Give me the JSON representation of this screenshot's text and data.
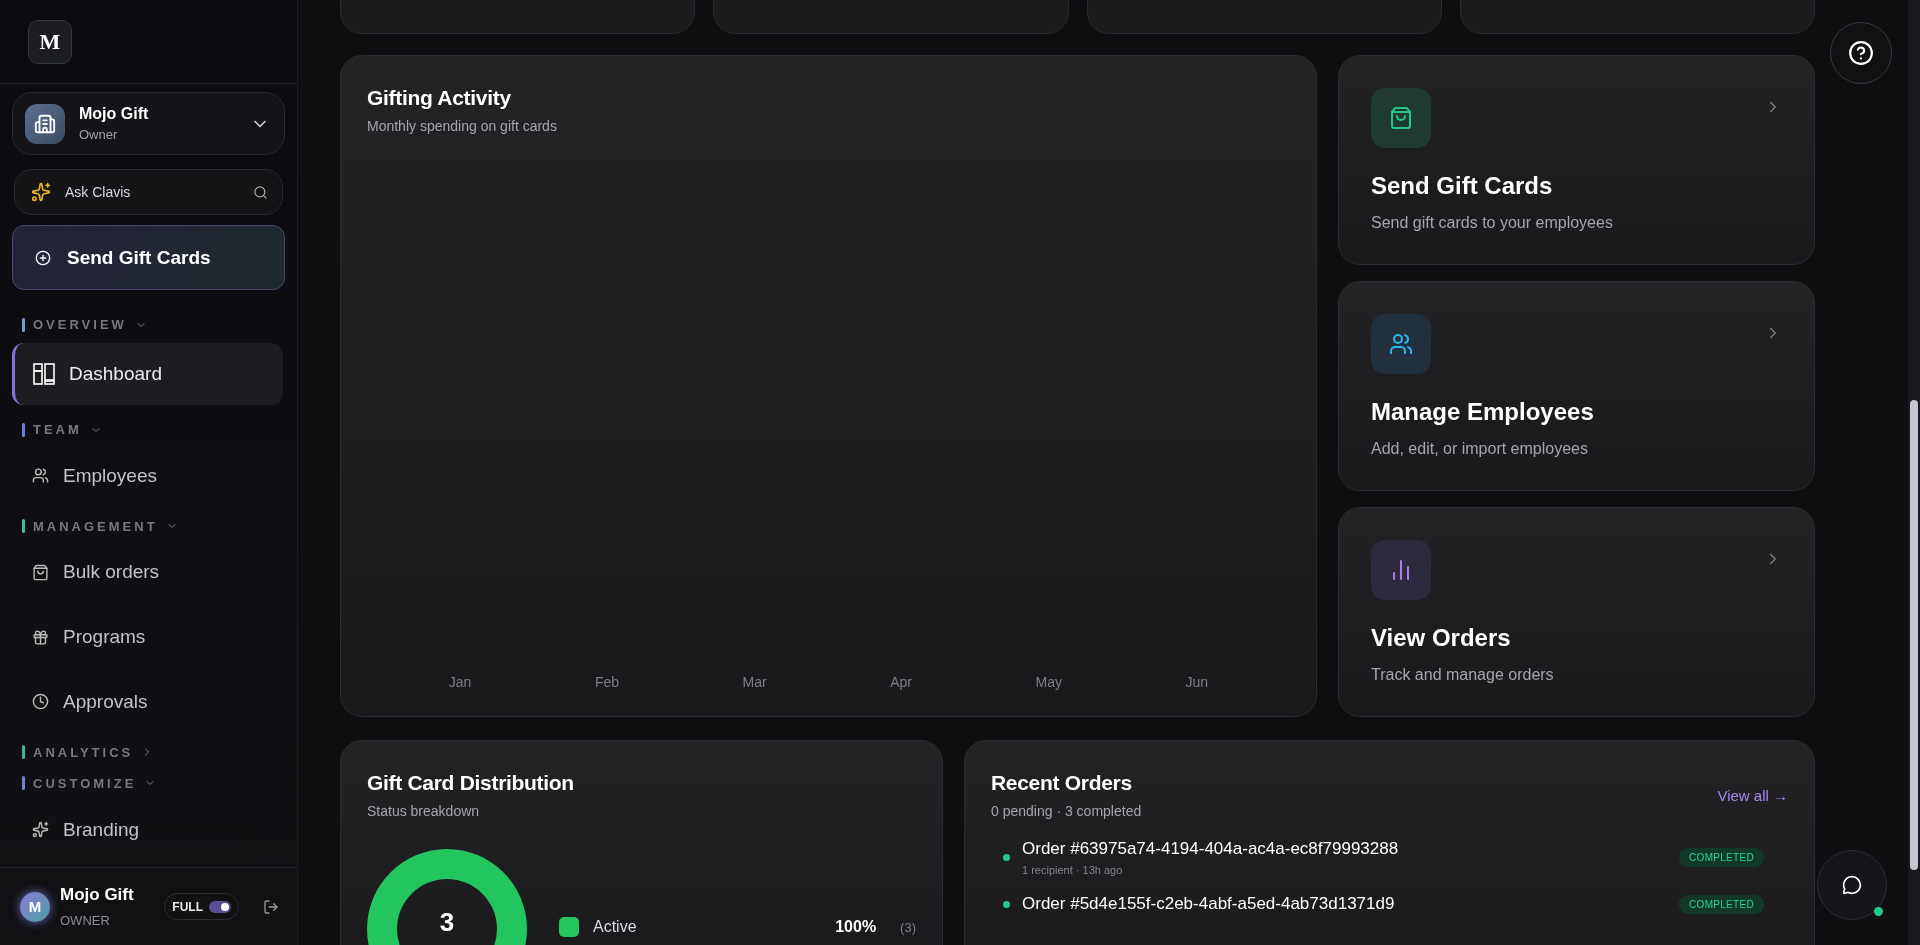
{
  "sidebar": {
    "logo": "M",
    "org": {
      "name": "Mojo Gift",
      "role": "Owner"
    },
    "ask": {
      "placeholder": "Ask Clavis"
    },
    "primary_button": "Send Gift Cards",
    "sections": [
      {
        "title": "OVERVIEW",
        "color": "#7c9ad0",
        "expanded": true,
        "items": [
          {
            "label": "Dashboard",
            "selected": true
          }
        ]
      },
      {
        "title": "TEAM",
        "color": "#6d7fe0",
        "expanded": true,
        "items": [
          {
            "label": "Employees",
            "selected": false
          }
        ]
      },
      {
        "title": "MANAGEMENT",
        "color": "#3fbf9f",
        "expanded": true,
        "items": [
          {
            "label": "Bulk orders",
            "selected": false
          },
          {
            "label": "Programs",
            "selected": false
          },
          {
            "label": "Approvals",
            "selected": false
          }
        ]
      },
      {
        "title": "ANALYTICS",
        "color": "#3fb99a",
        "expanded": false
      },
      {
        "title": "CUSTOMIZE",
        "color": "#7a7fd8",
        "expanded": true,
        "items": [
          {
            "label": "Branding",
            "selected": false
          }
        ]
      }
    ],
    "user": {
      "initial": "M",
      "name": "Mojo Gift",
      "role": "OWNER",
      "mode_label": "FULL",
      "mode_on": true
    }
  },
  "gifting_activity": {
    "title": "Gifting Activity",
    "subtitle": "Monthly spending on gift cards",
    "months": [
      "Jan",
      "Feb",
      "Mar",
      "Apr",
      "May",
      "Jun"
    ]
  },
  "actions": [
    {
      "title": "Send Gift Cards",
      "description": "Send gift cards to your employees",
      "color": "#22c98a"
    },
    {
      "title": "Manage Employees",
      "description": "Add, edit, or import employees",
      "color": "#2bb6f0"
    },
    {
      "title": "View Orders",
      "description": "Track and manage orders",
      "color": "#b07cf0"
    }
  ],
  "distribution": {
    "title": "Gift Card Distribution",
    "subtitle": "Status breakdown",
    "total": "3",
    "legend": [
      {
        "label": "Active",
        "color": "#22c55e",
        "percent": "100%",
        "count": "(3)"
      }
    ]
  },
  "recent_orders": {
    "title": "Recent Orders",
    "summary": "0 pending · 3 completed",
    "link": "View all →",
    "orders": [
      {
        "title": "Order #63975a74-4194-404a-ac4a-ec8f79993288",
        "meta": "1 recipient · 13h ago",
        "status": "COMPLETED",
        "color": "#22c98a"
      },
      {
        "title": "Order #5d4e155f-c2eb-4abf-a5ed-4ab73d1371d9",
        "status": "COMPLETED",
        "color": "#22c98a"
      }
    ]
  }
}
